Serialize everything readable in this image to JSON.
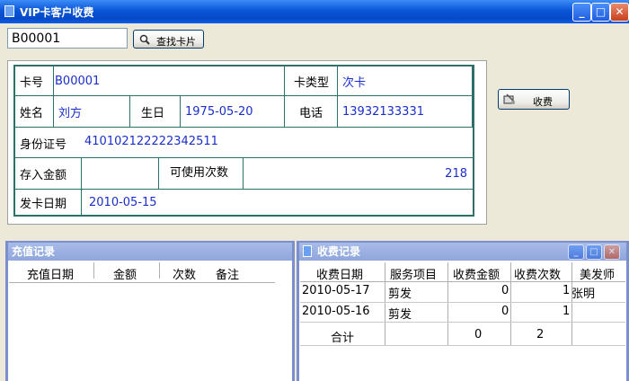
{
  "window": {
    "title": "VIP卡客户收费",
    "minimize": "_",
    "maximize": "□",
    "close": "✕"
  },
  "search": {
    "value": "B00001",
    "button_label": "查找卡片"
  },
  "charge_button": {
    "label": "收费"
  },
  "card": {
    "card_no_label": "卡号",
    "card_no": "B00001",
    "card_type_label": "卡类型",
    "card_type": "次卡",
    "name_label": "姓名",
    "name": "刘方",
    "birthday_label": "生日",
    "birthday": "1975-05-20",
    "phone_label": "电话",
    "phone": "13932133331",
    "id_label": "身份证号",
    "id_no": "410102122222342511",
    "deposit_label": "存入金额",
    "deposit": "",
    "times_label": "可使用次数",
    "times": "218",
    "issue_label": "发卡日期",
    "issue_date": "2010-05-15"
  },
  "recharge_panel": {
    "title": "充值记录",
    "columns": [
      "充值日期",
      "金额",
      "次数",
      "备注"
    ]
  },
  "fee_panel": {
    "title": "收费记录",
    "columns": [
      "收费日期",
      "服务项目",
      "收费金额",
      "收费次数",
      "美发师"
    ],
    "rows": [
      [
        "2010-05-17",
        "剪发",
        "0",
        "1",
        "张明"
      ],
      [
        "2010-05-16",
        "剪发",
        "0",
        "1",
        ""
      ]
    ],
    "total": [
      "合计",
      "",
      "0",
      "2",
      ""
    ]
  }
}
